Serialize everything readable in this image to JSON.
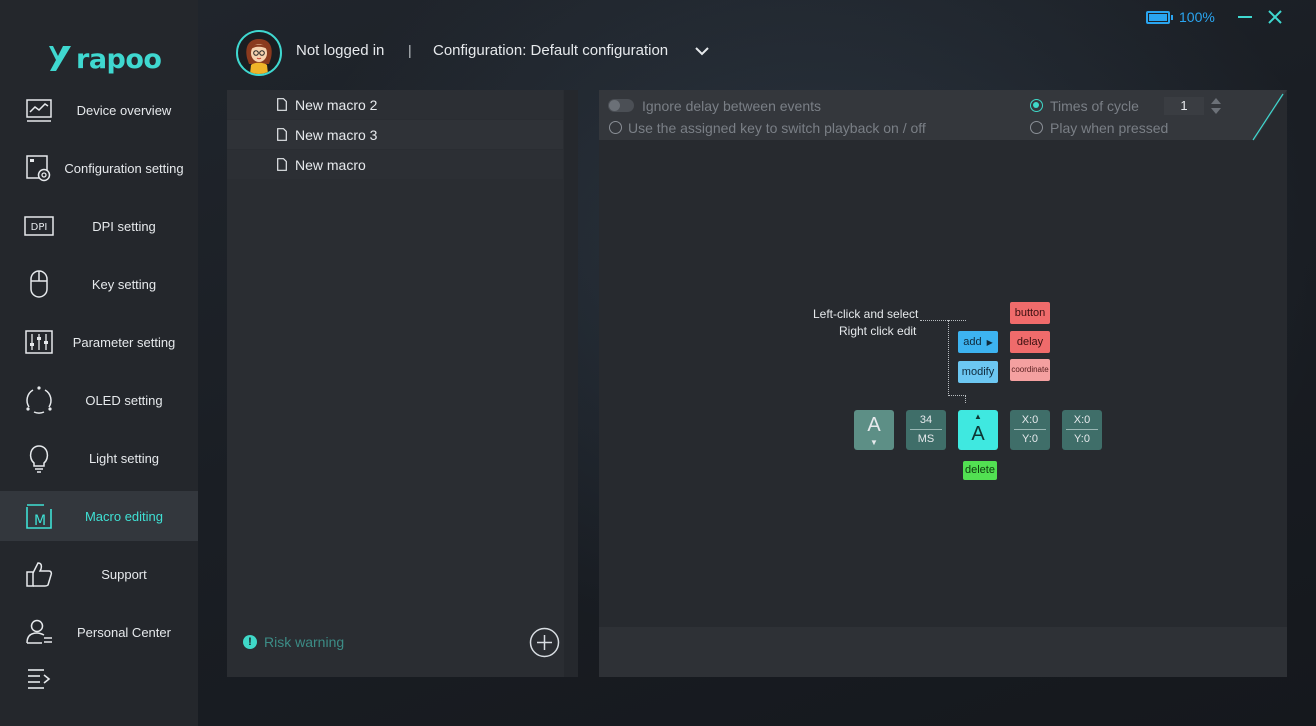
{
  "app": {
    "logo_text": "rapoo",
    "battery": "100%",
    "colors": {
      "accent": "#3fd8d0",
      "battery": "#2aa5f0",
      "red": "#ef6b6b",
      "green": "#52e052",
      "blue": "#3db3f0"
    }
  },
  "sidebar": {
    "items": [
      {
        "label": "Device overview",
        "icon": "monitor-chart-icon"
      },
      {
        "label": "Configuration setting",
        "icon": "config-gear-icon"
      },
      {
        "label": "DPI setting",
        "icon": "dpi-icon"
      },
      {
        "label": "Key setting",
        "icon": "mouse-icon"
      },
      {
        "label": "Parameter setting",
        "icon": "sliders-icon"
      },
      {
        "label": "OLED setting",
        "icon": "circle-dots-icon"
      },
      {
        "label": "Light setting",
        "icon": "bulb-icon"
      },
      {
        "label": "Macro editing",
        "icon": "macro-icon",
        "active": true
      },
      {
        "label": "Support",
        "icon": "thumbs-up-icon"
      },
      {
        "label": "Personal Center",
        "icon": "user-icon"
      }
    ],
    "dpi_icon_text": "DPI",
    "macro_icon_text": "M"
  },
  "header": {
    "login_status": "Not logged in",
    "separator": "|",
    "configuration": "Configuration: Default configuration"
  },
  "macro_list": {
    "items": [
      {
        "label": "New macro 2"
      },
      {
        "label": "New macro 3"
      },
      {
        "label": "New macro"
      }
    ],
    "risk_warning": "Risk warning",
    "risk_icon": "!"
  },
  "editor": {
    "ignore_delay": "Ignore delay between events",
    "assigned_key": "Use the assigned key to switch playback on / off",
    "times_of_cycle": "Times of cycle",
    "cycle_value": "1",
    "play_when_pressed": "Play when pressed",
    "hint_line1": "Left-click and select",
    "hint_line2": "Right click edit",
    "buttons": {
      "add": "add",
      "modify": "modify",
      "button": "button",
      "delay": "delay",
      "coordinate": "coordinate",
      "delete": "delete"
    },
    "events": [
      {
        "type": "key",
        "key": "A",
        "arrow": "▼"
      },
      {
        "type": "delay",
        "top": "34",
        "bottom": "MS"
      },
      {
        "type": "key-selected",
        "key": "A",
        "arrow": "▲"
      },
      {
        "type": "coord",
        "top": "X:0",
        "bottom": "Y:0"
      },
      {
        "type": "coord",
        "top": "X:0",
        "bottom": "Y:0"
      }
    ]
  }
}
